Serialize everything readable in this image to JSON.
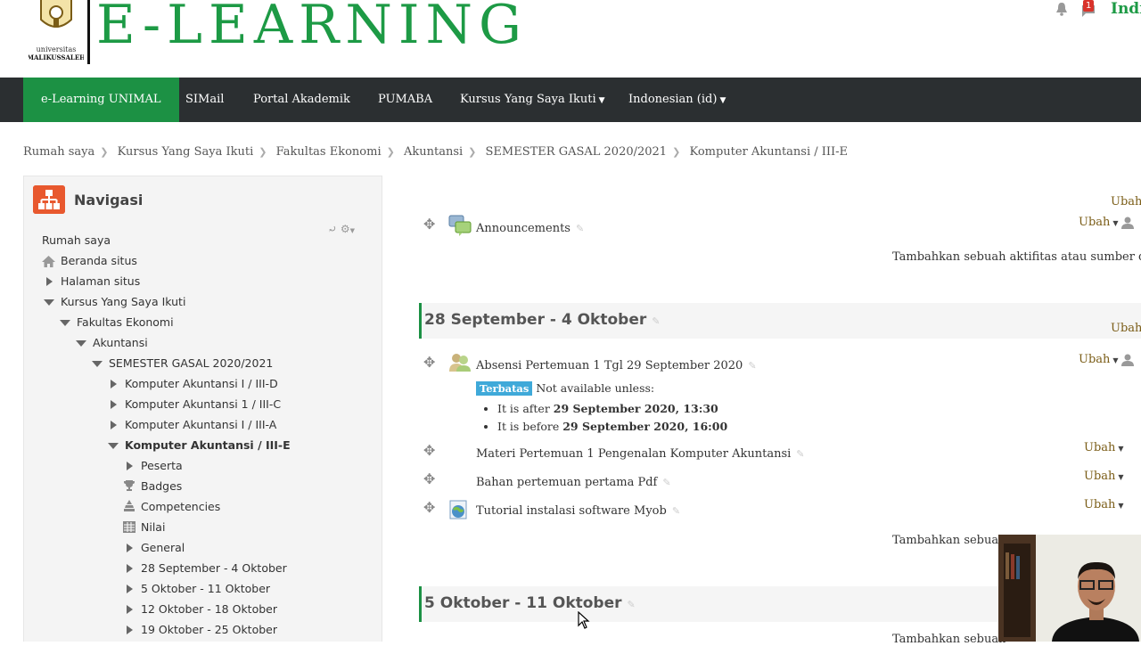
{
  "header": {
    "logo_text": "E-LEARNING",
    "logo_caption_top": "universitas",
    "logo_caption_bottom": "MALIKUSSALEH",
    "notification_count": "1",
    "user_name": "Indr",
    "brand_color": "#1d9a45"
  },
  "navbar": {
    "items": [
      {
        "label": "e-Learning UNIMAL",
        "active": true
      },
      {
        "label": "SIMail"
      },
      {
        "label": "Portal Akademik"
      },
      {
        "label": "PUMABA"
      },
      {
        "label": "Kursus Yang Saya Ikuti",
        "dropdown": true
      },
      {
        "label": "Indonesian (id)",
        "dropdown": true
      }
    ],
    "accent": "#1c9144",
    "background": "#2b2f31"
  },
  "breadcrumb": [
    "Rumah saya",
    "Kursus Yang Saya Ikuti",
    "Fakultas Ekonomi",
    "Akuntansi",
    "SEMESTER GASAL 2020/2021",
    "Komputer Akuntansi / III-E"
  ],
  "navigation": {
    "title": "Navigasi",
    "tree": [
      {
        "label": "Rumah saya"
      },
      {
        "label": "Beranda situs",
        "icon": "home-icon"
      },
      {
        "label": "Halaman situs",
        "icon": "collapsed"
      },
      {
        "label": "Kursus Yang Saya Ikuti",
        "icon": "expanded"
      },
      {
        "label": "Fakultas Ekonomi",
        "icon": "expanded"
      },
      {
        "label": "Akuntansi",
        "icon": "expanded"
      },
      {
        "label": "SEMESTER GASAL 2020/2021",
        "icon": "expanded"
      },
      {
        "label": "Komputer Akuntansi I / III-D",
        "icon": "collapsed"
      },
      {
        "label": "Komputer Akuntansi 1 / III-C",
        "icon": "collapsed"
      },
      {
        "label": "Komputer Akuntansi I / III-A",
        "icon": "collapsed"
      },
      {
        "label": "Komputer Akuntansi / III-E",
        "icon": "expanded",
        "bold": true
      },
      {
        "label": "Peserta",
        "icon": "collapsed"
      },
      {
        "label": "Badges",
        "icon": "trophy-icon"
      },
      {
        "label": "Competencies",
        "icon": "competency-icon"
      },
      {
        "label": "Nilai",
        "icon": "grades-icon"
      },
      {
        "label": "General",
        "icon": "collapsed"
      },
      {
        "label": "28 September - 4 Oktober",
        "icon": "collapsed"
      },
      {
        "label": "5 Oktober - 11 Oktober",
        "icon": "collapsed"
      },
      {
        "label": "12 Oktober - 18 Oktober",
        "icon": "collapsed"
      },
      {
        "label": "19 Oktober - 25 Oktober",
        "icon": "collapsed"
      }
    ]
  },
  "main": {
    "edit_label": "Ubah",
    "announcements": "Announcements",
    "add_activity": "Tambahkan sebuah aktifitas atau sumber daya",
    "add_activity_short": "Tambahkan sebuah",
    "sections": [
      {
        "title": "28 September - 4 Oktober",
        "activities": [
          {
            "label": "Absensi Pertemuan 1 Tgl 29 September 2020",
            "icon": "attendance-icon"
          },
          {
            "label": "Materi Pertemuan 1 Pengenalan Komputer Akuntansi"
          },
          {
            "label": "Bahan pertemuan pertama Pdf"
          },
          {
            "label": "Tutorial instalasi software Myob",
            "icon": "url-icon"
          }
        ],
        "restriction": {
          "badge": "Terbatas",
          "text": "Not available unless:",
          "conditions": [
            {
              "prefix": "It is after",
              "value": "29 September 2020, 13:30"
            },
            {
              "prefix": "It is before",
              "value": "29 September 2020, 16:00"
            }
          ]
        }
      },
      {
        "title": "5 Oktober - 11 Oktober"
      }
    ]
  }
}
